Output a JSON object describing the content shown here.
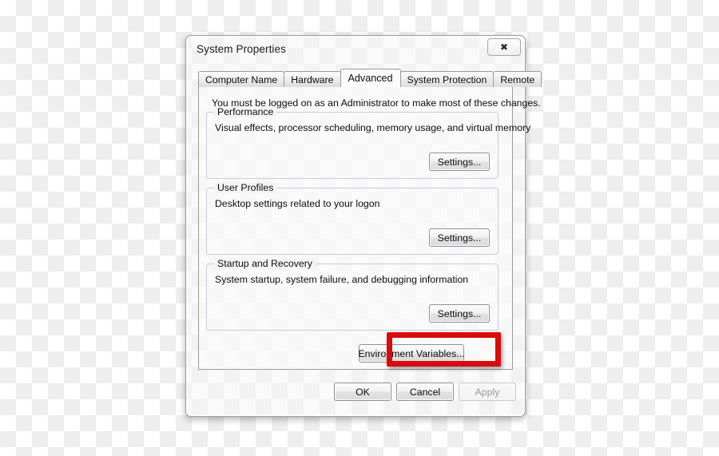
{
  "window": {
    "title": "System Properties",
    "close_icon": "close-x-icon",
    "close_glyph": "✖"
  },
  "tabs": [
    {
      "label": "Computer Name",
      "selected": false
    },
    {
      "label": "Hardware",
      "selected": false
    },
    {
      "label": "Advanced",
      "selected": true
    },
    {
      "label": "System Protection",
      "selected": false
    },
    {
      "label": "Remote",
      "selected": false
    }
  ],
  "advanced_panel": {
    "notice": "You must be logged on as an Administrator to make most of these changes.",
    "groups": [
      {
        "legend": "Performance",
        "description": "Visual effects, processor scheduling, memory usage, and virtual memory",
        "button_label": "Settings..."
      },
      {
        "legend": "User Profiles",
        "description": "Desktop settings related to your logon",
        "button_label": "Settings..."
      },
      {
        "legend": "Startup and Recovery",
        "description": "System startup, system failure, and debugging information",
        "button_label": "Settings..."
      }
    ],
    "environment_variables_button": "Environment Variables...",
    "highlight_color": "#d80c0c"
  },
  "footer": {
    "ok_label": "OK",
    "cancel_label": "Cancel",
    "apply_label": "Apply",
    "apply_enabled": false
  }
}
